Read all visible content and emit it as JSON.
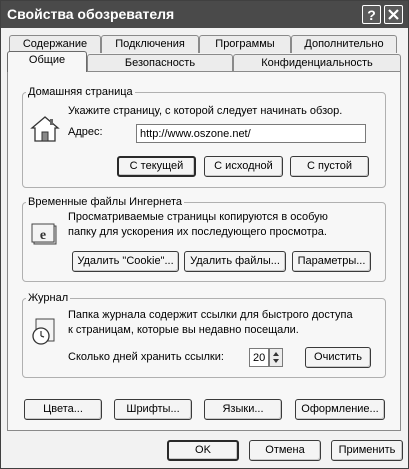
{
  "window": {
    "title": "Свойства обозревателя"
  },
  "tabs_row1": [
    {
      "label": "Содержание"
    },
    {
      "label": "Подключения"
    },
    {
      "label": "Программы"
    },
    {
      "label": "Дополнительно"
    }
  ],
  "tabs_row2": [
    {
      "label": "Общие",
      "active": true
    },
    {
      "label": "Безопасность"
    },
    {
      "label": "Конфиденциальность"
    }
  ],
  "home": {
    "group_label": "Домашняя страница",
    "description": "Укажите страницу, с которой следует начинать обзор.",
    "address_label": "Адрес:",
    "address_value": "http://www.oszone.net/",
    "btn_current": "С текущей",
    "btn_default": "С исходной",
    "btn_blank": "С пустой"
  },
  "temp": {
    "group_label": "Временные файлы Ингернета",
    "description_line1": "Просматриваемые страницы копируются в особую",
    "description_line2": "папку для ускорения их последующего просмотра.",
    "btn_cookies": "Удалить \"Cookie\"...",
    "btn_files": "Удалить файлы...",
    "btn_settings": "Параметры..."
  },
  "history": {
    "group_label": "Журнал",
    "description_line1": "Папка журнала содержит ссылки для быстрого доступа",
    "description_line2": "к страницам, которые вы недавно посещали.",
    "days_label": "Сколько дней хранить ссылки:",
    "days_value": "20",
    "btn_clear": "Очистить"
  },
  "bottom_buttons": {
    "colors": "Цвета...",
    "fonts": "Шрифты...",
    "languages": "Языки...",
    "accessibility": "Оформление..."
  },
  "dialog_buttons": {
    "ok": "OK",
    "cancel": "Отмена",
    "apply": "Применить"
  }
}
